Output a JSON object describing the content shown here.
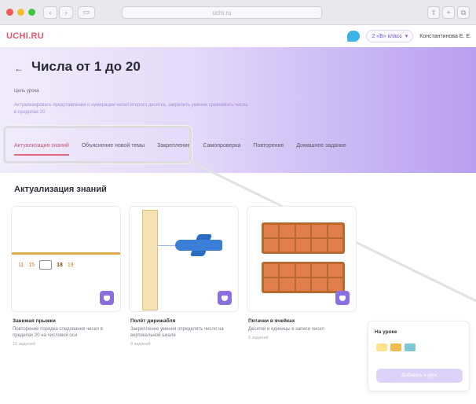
{
  "browser": {
    "url": "uchi.ru"
  },
  "header": {
    "logo": "UCHI.RU",
    "class_select": "2 «Б» класс",
    "user_name": "Константинова Е. Е."
  },
  "hero": {
    "title": "Числа от 1 до 20",
    "lesson_label": "Цель урока",
    "description": "Актуализировать представления о нумерации чисел второго десятка, закрепить умение сравнивать числа в пределах 20"
  },
  "tabs": [
    {
      "label": "Актуализация знаний",
      "active": true
    },
    {
      "label": "Объяснение новой темы",
      "active": false
    },
    {
      "label": "Закрепление",
      "active": false
    },
    {
      "label": "Самопроверка",
      "active": false
    },
    {
      "label": "Повторение",
      "active": false
    },
    {
      "label": "Домашнее задание",
      "active": false
    }
  ],
  "section": {
    "title": "Актуализация знаний"
  },
  "cards": [
    {
      "title": "Занимая прыжки",
      "description": "Повторение порядка следования чисел в пределах 20 на числовой оси",
      "meta": "15 заданий",
      "numline": [
        "11",
        "15",
        "18",
        "19"
      ]
    },
    {
      "title": "Полёт дирижабля",
      "description": "Закрепление умения определять число на вертикальной шкале",
      "meta": "8 заданий"
    },
    {
      "title": "Пятачки в ячейках",
      "description": "Десятки и единицы в записи чисел",
      "meta": "8 заданий"
    }
  ],
  "side_panel": {
    "title": "На уроке",
    "button": "Добавить в урок"
  },
  "colors": {
    "accent": "#8a6fe0",
    "brand": "#e3566f",
    "active_tab": "#e06780"
  }
}
